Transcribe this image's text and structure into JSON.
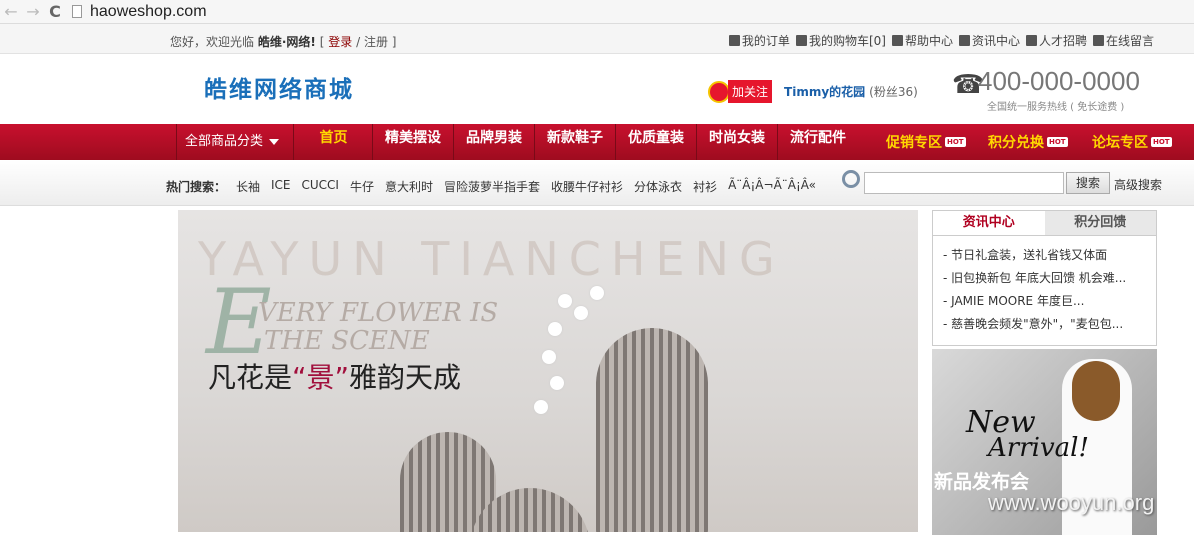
{
  "browser": {
    "url": "haoweshop.com",
    "back": "←",
    "forward": "→",
    "reload": "C"
  },
  "topbar": {
    "greeting": "您好，欢迎光临",
    "site_name": "皓维·网络!",
    "bracket_open": "[",
    "login": "登录",
    "slash": "/",
    "register": "注册",
    "bracket_close": "]",
    "links": [
      "我的订单",
      "我的购物车[0]",
      "帮助中心",
      "资讯中心",
      "人才招聘",
      "在线留言"
    ]
  },
  "header": {
    "logo": "皓维网络商城",
    "follow": "加关注",
    "weibo_name": "Timmy的花园",
    "weibo_fans": "(粉丝36)",
    "phone": "400-000-0000",
    "phone_sub": "全国统一服务热线 ( 免长途费 )"
  },
  "nav": {
    "all_categories": "全部商品分类",
    "items": [
      "首页",
      "精美摆设",
      "品牌男装",
      "新款鞋子",
      "优质童装",
      "时尚女装",
      "流行配件"
    ],
    "promos": [
      "促销专区",
      "积分兑换",
      "论坛专区"
    ],
    "hot": "HOT"
  },
  "search": {
    "hot_label": "热门搜索：",
    "hot_words": [
      "长袖",
      "ICE",
      "CUCCI",
      "牛仔",
      "意大利时",
      "冒险菠萝半指手套",
      "收腰牛仔衬衫",
      "分体泳衣",
      "衬衫",
      "Ã¨Â¡Â¬Ã¨Â¡Â«"
    ],
    "button": "搜索",
    "advanced": "高级搜索",
    "placeholder": ""
  },
  "banner": {
    "top_line": "YAYUN   TIANCHENG",
    "big_letter": "E",
    "line1": "VERY FLOWER IS",
    "line2": "THE SCENE",
    "slogan_pre": "凡花是",
    "slogan_quote": "“景”",
    "slogan_post": "雅韵天成"
  },
  "sidebar": {
    "tab_news": "资讯中心",
    "tab_points": "积分回馈",
    "news": [
      "- 节日礼盒装，送礼省钱又体面",
      "- 旧包换新包 年底大回馈 机会难...",
      "- JAMIE MOORE 年度巨...",
      "- 慈善晚会频发\"意外\"，\"麦包包..."
    ],
    "ad_new": "New",
    "ad_arrival": "Arrival!",
    "ad_cn": "新品发布会"
  },
  "watermark": "www.wooyun.org",
  "colors": {
    "brand_red": "#c8102e",
    "logo_blue": "#1a6fb9",
    "promo_yellow": "#ffd800"
  }
}
